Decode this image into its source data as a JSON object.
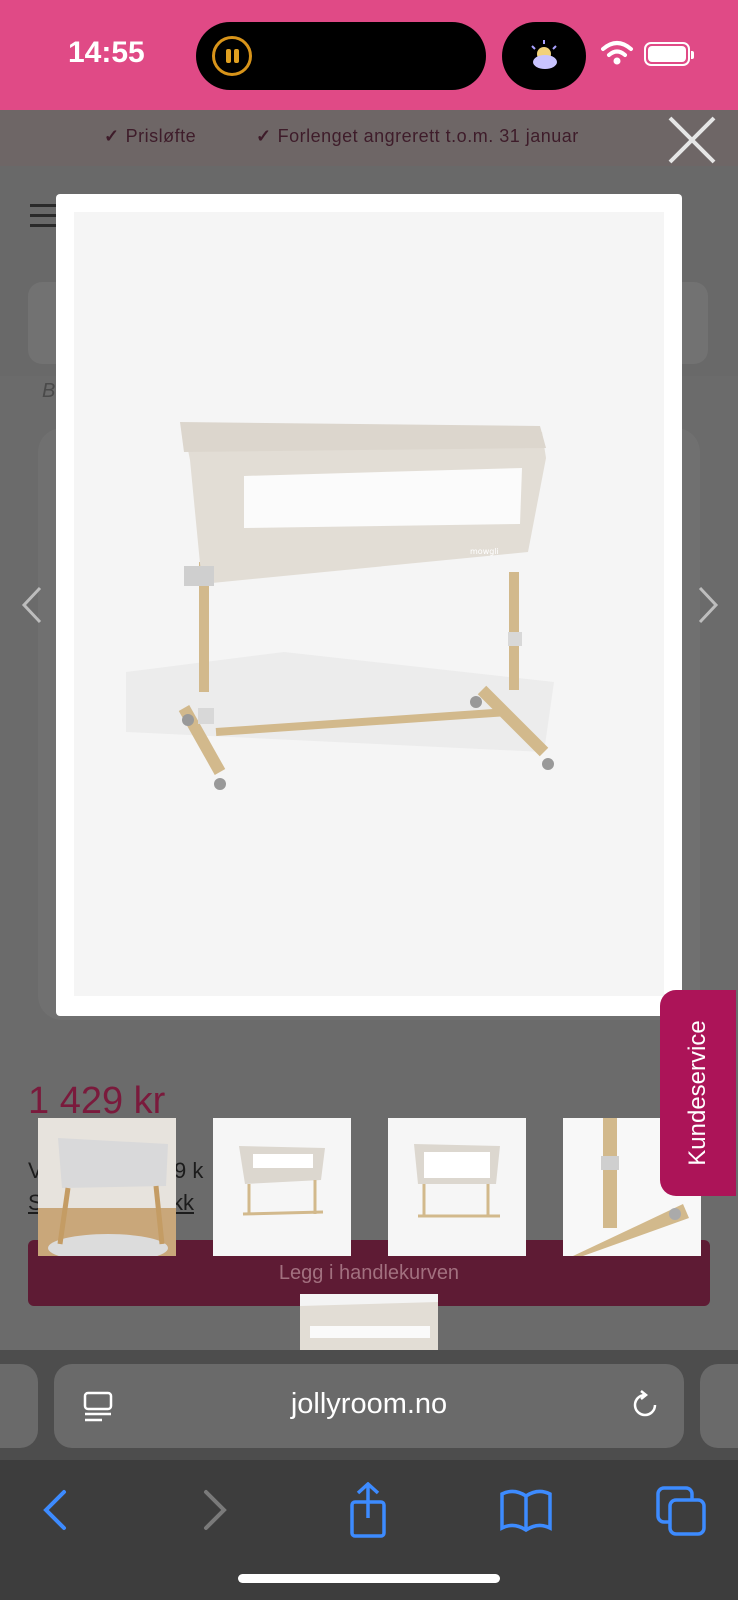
{
  "status_bar": {
    "time": "14:55",
    "background_color": "#e04a86",
    "icons": [
      "pause-icon",
      "weather-icon",
      "wifi-icon",
      "battery-icon"
    ]
  },
  "promo": {
    "items": [
      "Prisløfte",
      "Forlenget angrerett t.o.m. 31 januar"
    ]
  },
  "background_page": {
    "breadcrumb_fragment": "B",
    "price": "1 429 kr",
    "subtext_1_start": "V",
    "subtext_1_end": "9 k",
    "subtext_2_start": "S",
    "subtext_2_end": "kk",
    "add_to_cart_label": "Legg i handlekurven"
  },
  "gallery": {
    "thumbnail_count": 5,
    "image_alt": "Bedside crib"
  },
  "customer_service": {
    "label": "Kundeservice",
    "color": "#ac1458"
  },
  "browser": {
    "url": "jollyroom.no",
    "toolbar_icons": [
      "back-icon",
      "forward-icon",
      "share-icon",
      "bookmarks-icon",
      "tabs-icon"
    ]
  }
}
